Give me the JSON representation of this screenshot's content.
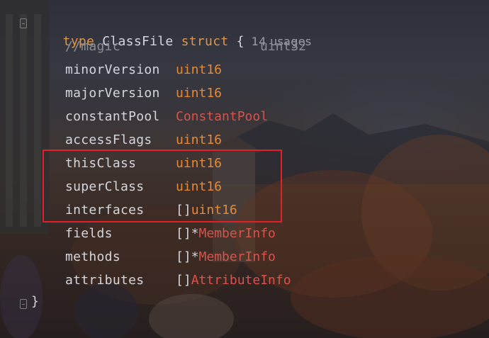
{
  "code": {
    "header": {
      "keyword_type": "type",
      "name": "ClassFile",
      "keyword_struct": "struct",
      "brace_open": "{",
      "usages": "14 usages"
    },
    "fields": [
      {
        "name": "//magic",
        "type": "uint32",
        "prefix": ""
      },
      {
        "name": "minorVersion",
        "type": "uint16",
        "prefix": ""
      },
      {
        "name": "majorVersion",
        "type": "uint16",
        "prefix": ""
      },
      {
        "name": "constantPool",
        "type": "ConstantPool",
        "prefix": ""
      },
      {
        "name": "accessFlags",
        "type": "uint16",
        "prefix": ""
      },
      {
        "name": "thisClass",
        "type": "uint16",
        "prefix": ""
      },
      {
        "name": "superClass",
        "type": "uint16",
        "prefix": ""
      },
      {
        "name": "interfaces",
        "type": "uint16",
        "prefix": "[]"
      },
      {
        "name": "fields",
        "type": "MemberInfo",
        "prefix": "[]*"
      },
      {
        "name": "methods",
        "type": "MemberInfo",
        "prefix": "[]*"
      },
      {
        "name": "attributes",
        "type": "AttributeInfo",
        "prefix": "[]"
      }
    ],
    "brace_close": "}"
  },
  "highlight": {
    "color": "#e3202a",
    "covers": [
      "thisClass",
      "superClass",
      "interfaces"
    ]
  },
  "colors": {
    "keyword": "#e0964a",
    "builtin_type": "#e28a3b",
    "user_type": "#d9534c",
    "identifier": "#d4d6dc",
    "comment": "#8b8e98"
  }
}
